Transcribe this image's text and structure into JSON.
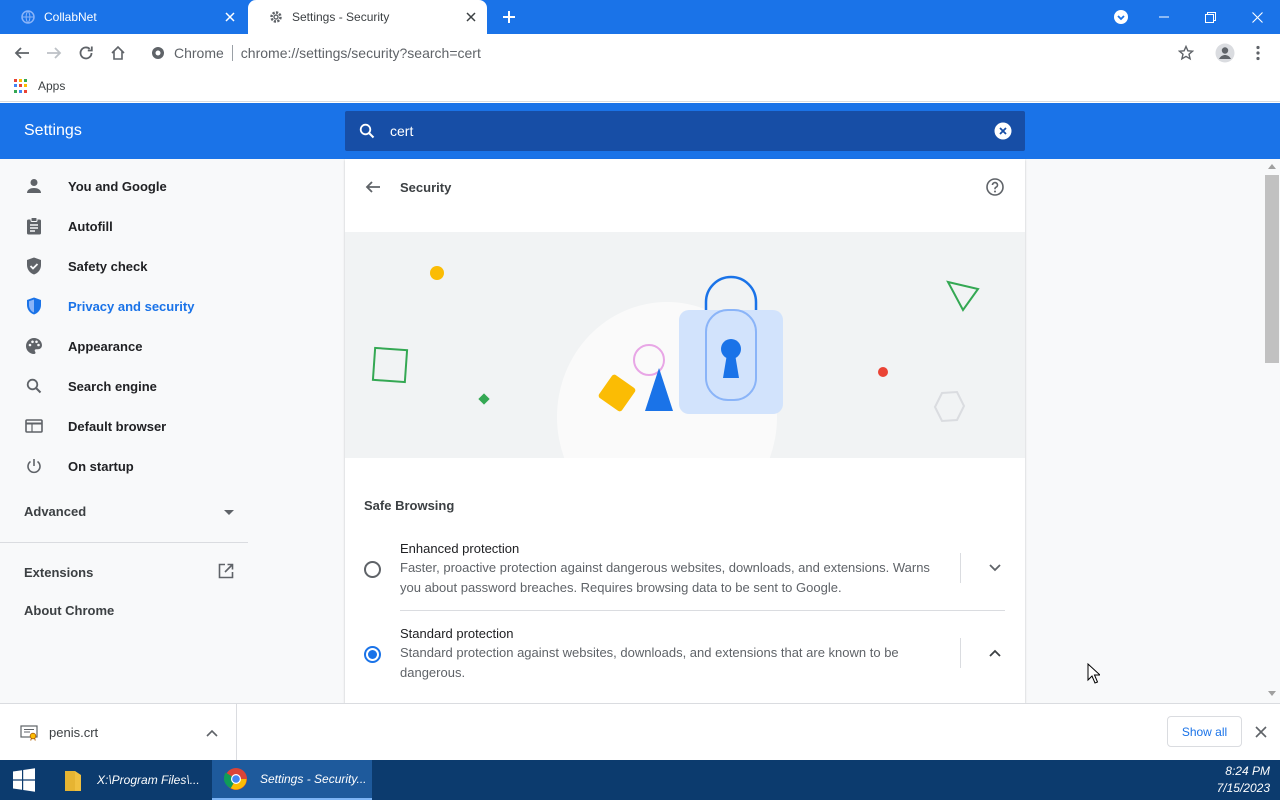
{
  "browser": {
    "tabs": [
      {
        "title": "CollabNet",
        "active": false
      },
      {
        "title": "Settings - Security",
        "active": true
      }
    ],
    "omnibox": {
      "site_chip": "Chrome",
      "url": "chrome://settings/security?search=cert"
    },
    "bookmarks": {
      "apps_label": "Apps"
    }
  },
  "settings": {
    "header_title": "Settings",
    "search_value": "cert",
    "sidebar": {
      "items": [
        {
          "label": "You and Google",
          "icon": "person-icon"
        },
        {
          "label": "Autofill",
          "icon": "clipboard-icon"
        },
        {
          "label": "Safety check",
          "icon": "shield-check-icon"
        },
        {
          "label": "Privacy and security",
          "icon": "shield-icon",
          "active": true
        },
        {
          "label": "Appearance",
          "icon": "palette-icon"
        },
        {
          "label": "Search engine",
          "icon": "search-icon"
        },
        {
          "label": "Default browser",
          "icon": "browser-icon"
        },
        {
          "label": "On startup",
          "icon": "power-icon"
        }
      ],
      "advanced_label": "Advanced",
      "extensions_label": "Extensions",
      "about_label": "About Chrome"
    },
    "page": {
      "title": "Security",
      "section_title": "Safe Browsing",
      "options": [
        {
          "title": "Enhanced protection",
          "description": "Faster, proactive protection against dangerous websites, downloads, and extensions. Warns you about password breaches. Requires browsing data to be sent to Google.",
          "selected": false,
          "expanded": false
        },
        {
          "title": "Standard protection",
          "description": "Standard protection against websites, downloads, and extensions that are known to be dangerous.",
          "selected": true,
          "expanded": true
        }
      ]
    }
  },
  "downloads": {
    "file_name": "penis.crt",
    "show_all_label": "Show all"
  },
  "taskbar": {
    "tasks": [
      {
        "label": "X:\\Program Files\\...",
        "icon": "folder-icon",
        "active": false
      },
      {
        "label": "Settings - Security...",
        "icon": "chrome-icon",
        "active": true
      }
    ],
    "time": "8:24 PM",
    "date": "7/15/2023"
  },
  "colors": {
    "accent": "#1a73e8",
    "header_search_bg": "#174ea6",
    "sidebar_bg": "#f8f9fa",
    "taskbar_bg": "#0c3b6e"
  }
}
